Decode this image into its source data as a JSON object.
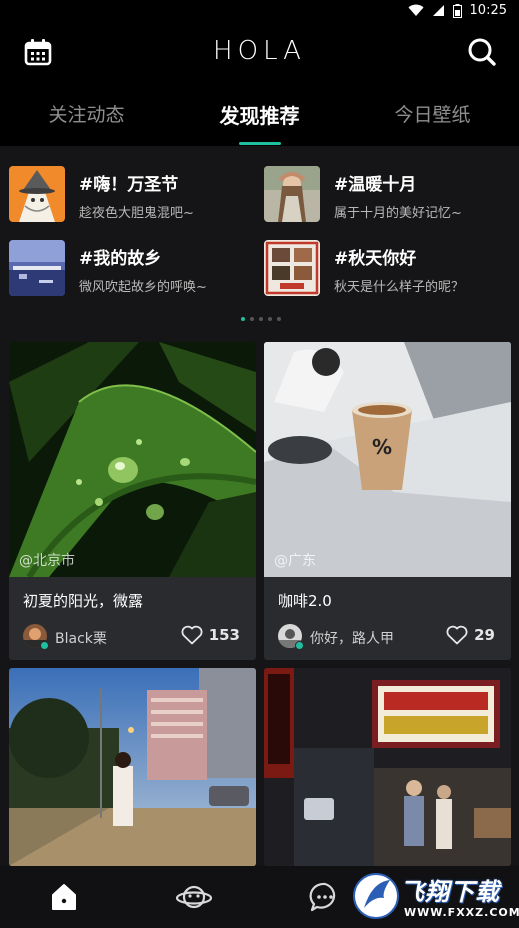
{
  "status_bar": {
    "time": "10:25",
    "icons": [
      "wifi-icon",
      "signal-icon",
      "battery-icon"
    ]
  },
  "header": {
    "logo": "HOLA",
    "left_icon": "calendar-icon",
    "right_icon": "search-icon"
  },
  "tabs": [
    {
      "label": "关注动态",
      "active": false
    },
    {
      "label": "发现推荐",
      "active": true
    },
    {
      "label": "今日壁纸",
      "active": false
    }
  ],
  "topics": [
    {
      "title": "#嗨！万圣节",
      "subtitle": "趁夜色大胆鬼混吧~"
    },
    {
      "title": "#温暖十月",
      "subtitle": "属于十月的美好记忆~"
    },
    {
      "title": "#我的故乡",
      "subtitle": "微风吹起故乡的呼唤~"
    },
    {
      "title": "#秋天你好",
      "subtitle": "秋天是什么样子的呢？"
    }
  ],
  "carousel": {
    "total": 5,
    "active": 0
  },
  "posts": [
    {
      "location": "@北京市",
      "title": "初夏的阳光，微露",
      "author": "Black栗",
      "likes": "153"
    },
    {
      "location": "@广东",
      "title": "咖啡2.0",
      "author": "你好，路人甲",
      "likes": "29"
    },
    {
      "location": "",
      "title": "",
      "author": "",
      "likes": ""
    },
    {
      "location": "",
      "title": "",
      "author": "",
      "likes": ""
    }
  ],
  "bottom_nav": [
    {
      "icon": "home-icon",
      "active": true
    },
    {
      "icon": "planet-icon",
      "active": false
    },
    {
      "icon": "chat-icon",
      "active": false
    }
  ],
  "watermark": {
    "text": "飞翔下载",
    "url": "WWW.FXXZ.COM"
  },
  "colors": {
    "accent": "#1fbf9f",
    "background": "#000000",
    "content_bg": "#151517",
    "card_bg": "#2a2b2f"
  }
}
